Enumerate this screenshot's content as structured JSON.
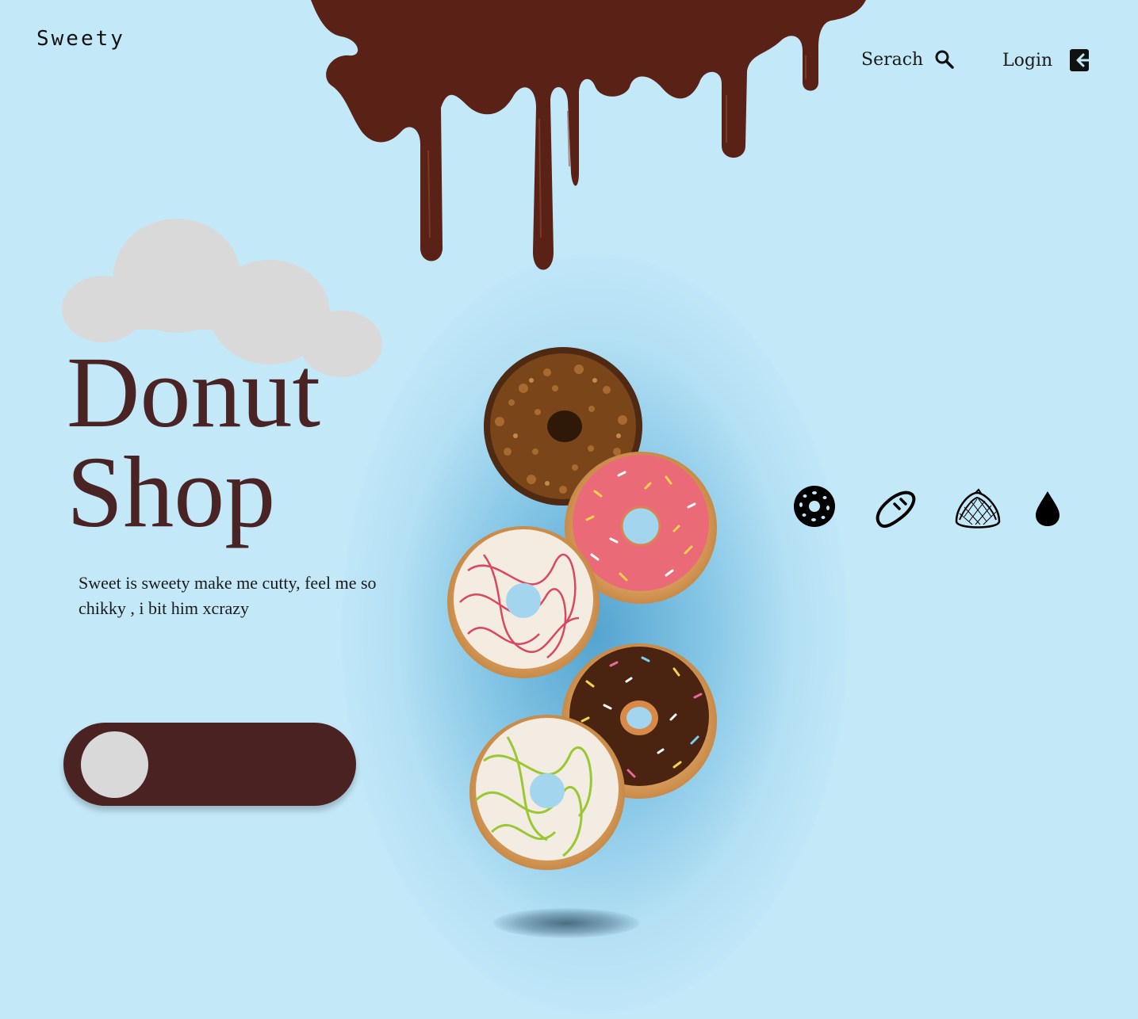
{
  "brand": {
    "name": "Sweety"
  },
  "nav": {
    "search_label": "Serach",
    "login_label": "Login"
  },
  "hero": {
    "title_line1": "Donut",
    "title_line2": "Shop",
    "tagline": "Sweet is sweety make me cutty, feel me so chikky , i bit him xcrazy"
  },
  "categories": [
    {
      "icon": "donut-icon"
    },
    {
      "icon": "bread-icon"
    },
    {
      "icon": "sandwich-icon"
    },
    {
      "icon": "drop-icon"
    }
  ],
  "colors": {
    "background": "#c3e9f9",
    "chocolate": "#5a2216",
    "title": "#4a2424",
    "toggle": "#4a2222",
    "cloud": "#d9d9d9"
  }
}
